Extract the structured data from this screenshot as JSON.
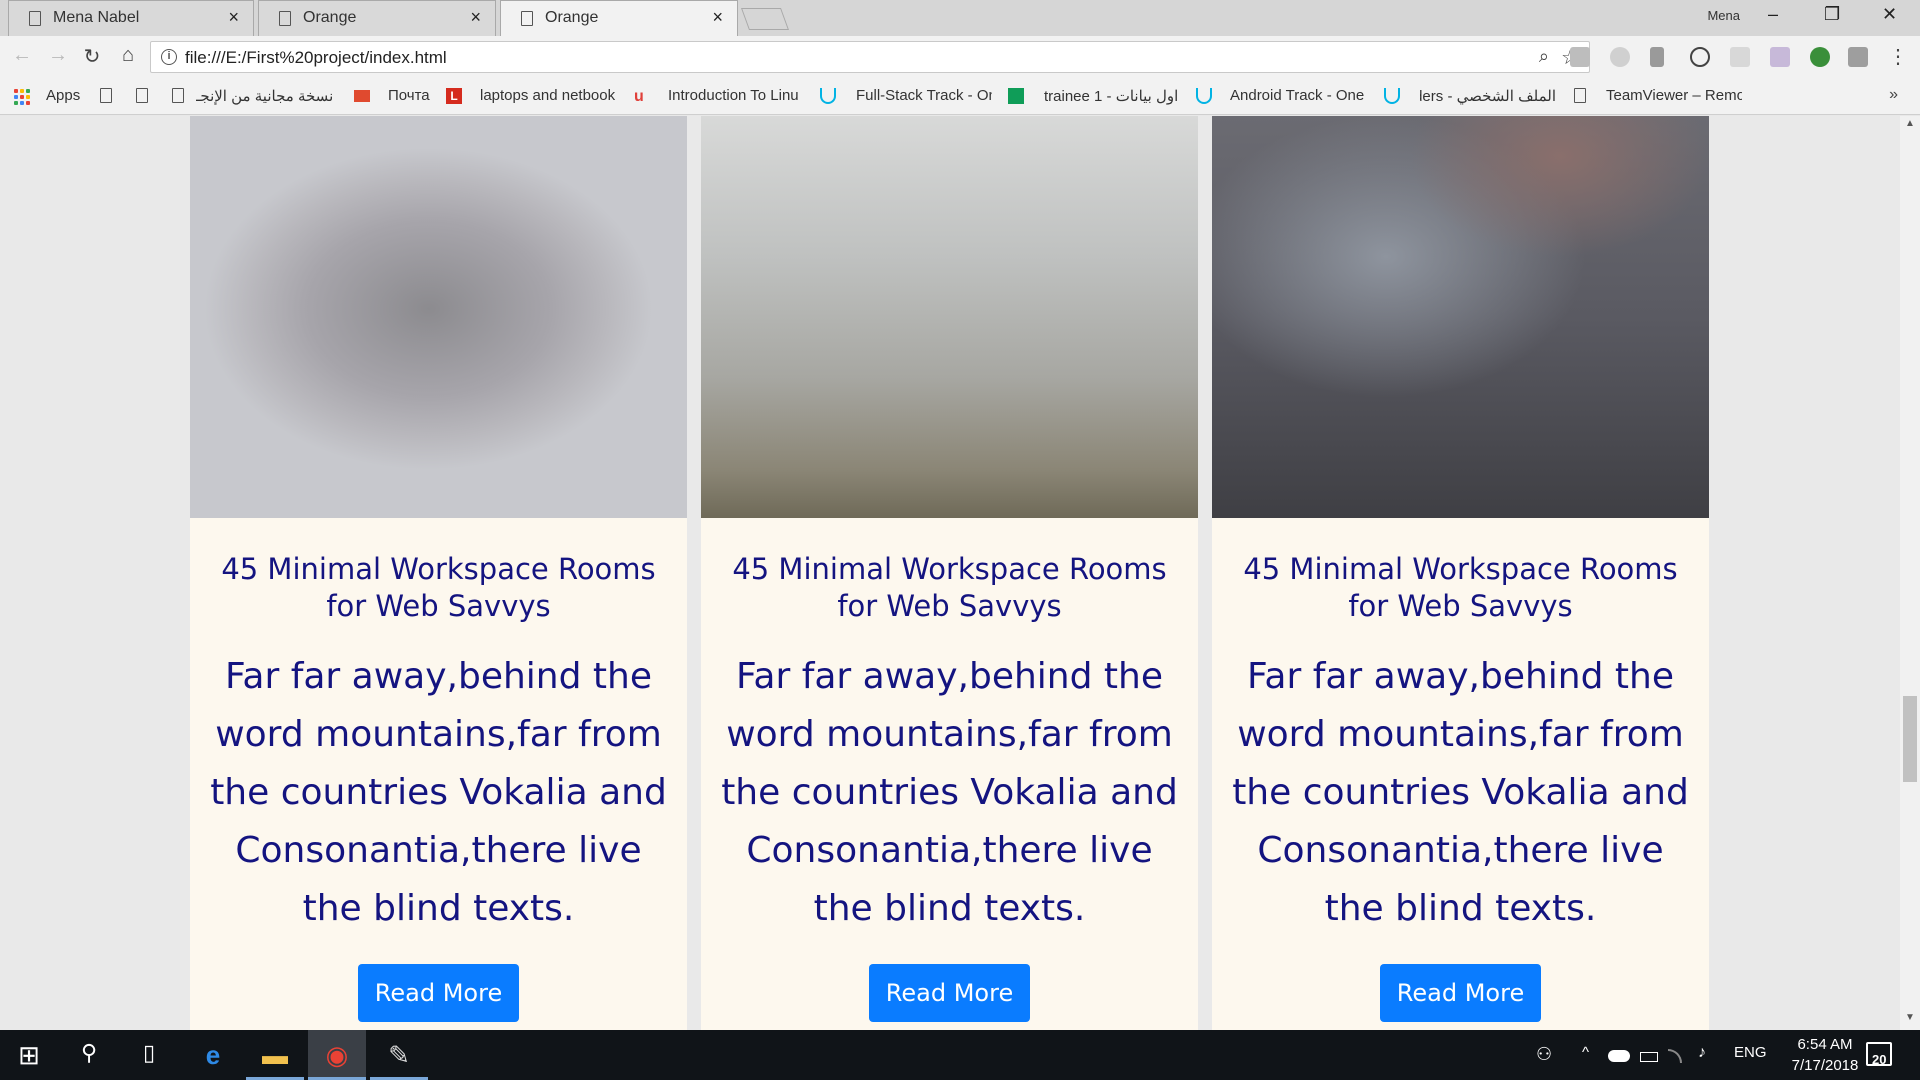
{
  "browser": {
    "tabs": [
      {
        "title": "Mena Nabel",
        "close": "×"
      },
      {
        "title": "Orange",
        "close": "×"
      },
      {
        "title": "Orange",
        "close": "×"
      }
    ],
    "window_user": "Mena",
    "window_controls": {
      "minimize": "–",
      "restore": "❐",
      "close": "✕"
    },
    "nav": {
      "back": "←",
      "forward": "→",
      "reload": "↻",
      "home": "⌂"
    },
    "address_bar": {
      "info": "i",
      "url": "file:///E:/First%20project/index.html",
      "zoom": "⌕",
      "star": "☆"
    },
    "menu": "⋮"
  },
  "bookmarks": {
    "apps_label": "Apps",
    "items": [
      {
        "label": "",
        "icon": "page-icon"
      },
      {
        "label": "",
        "icon": "page-icon"
      },
      {
        "label": "نسخة مجانية من الإنجـ",
        "icon": "page-icon"
      },
      {
        "label": "Почта",
        "icon": "mail-icon"
      },
      {
        "label": "laptops and netbook",
        "icon": "l-logo-icon"
      },
      {
        "label": "Introduction To Linu",
        "icon": "udemy-icon"
      },
      {
        "label": "Full-Stack Track - On",
        "icon": "udacity-icon"
      },
      {
        "label": "trainee 1 - اول بيانات",
        "icon": "sheets-icon"
      },
      {
        "label": "Android Track - One",
        "icon": "udacity-icon"
      },
      {
        "label": "الملف الشخصي - ders",
        "icon": "udacity-icon"
      },
      {
        "label": "TeamViewer – Remo",
        "icon": "page-icon"
      }
    ],
    "more": "»"
  },
  "cards": [
    {
      "title": "45 Minimal Workspace Rooms for Web Savvys",
      "body": "Far far away,behind the word mountains,far from the countries Vokalia and Consonantia,there live the blind texts.",
      "button": "Read More"
    },
    {
      "title": "45 Minimal Workspace Rooms for Web Savvys",
      "body": "Far far away,behind the word mountains,far from the countries Vokalia and Consonantia,there live the blind texts.",
      "button": "Read More"
    },
    {
      "title": "45 Minimal Workspace Rooms for Web Savvys",
      "body": "Far far away,behind the word mountains,far from the countries Vokalia and Consonantia,there live the blind texts.",
      "button": "Read More"
    }
  ],
  "scrollbar": {
    "up": "▲",
    "down": "▼"
  },
  "taskbar": {
    "start": "⊞",
    "search": "⚲",
    "task_view": "▯",
    "apps": [
      {
        "name": "edge",
        "glyph": "e"
      },
      {
        "name": "file-explorer",
        "glyph": "▬"
      },
      {
        "name": "chrome",
        "glyph": "◉"
      },
      {
        "name": "paint",
        "glyph": "✎"
      }
    ],
    "tray": {
      "people": "⚇",
      "chevron": "^",
      "language": "ENG",
      "volume": "♪"
    },
    "clock": {
      "time": "6:54 AM",
      "date": "7/17/2018"
    },
    "notifications": "20"
  },
  "colors": {
    "card_bg": "#fdf8ee",
    "heading": "#141480",
    "button": "#0a7cff",
    "taskbar": "#101418"
  }
}
